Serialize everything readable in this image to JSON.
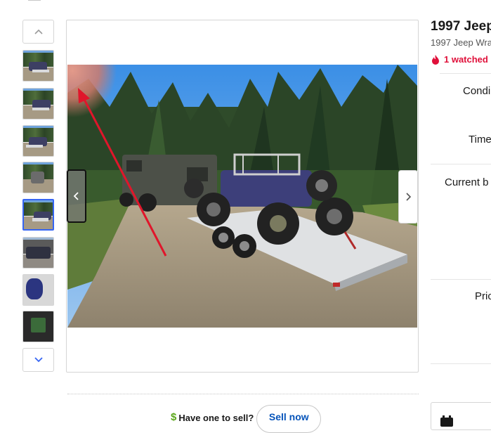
{
  "gallery": {
    "thumbnails": [
      {
        "label": "photo-1"
      },
      {
        "label": "photo-2"
      },
      {
        "label": "photo-3"
      },
      {
        "label": "photo-4"
      },
      {
        "label": "photo-5"
      },
      {
        "label": "photo-6"
      },
      {
        "label": "photo-7"
      },
      {
        "label": "photo-8"
      }
    ],
    "active_index": 4,
    "icons": {
      "up": "chevron-up-icon",
      "down": "chevron-down-icon",
      "prev": "chevron-left-icon",
      "next": "chevron-right-icon"
    }
  },
  "listing": {
    "title": "1997 Jeep",
    "subtitle": "1997 Jeep Wra",
    "watched": "1 watched",
    "labels": {
      "condition": "Condi",
      "time": "Time",
      "current_bid": "Current b",
      "price": "Pric"
    }
  },
  "sell": {
    "question": "Have one to sell?",
    "button": "Sell now"
  },
  "colors": {
    "accent_blue": "#3665f3",
    "link_blue": "#0654ba",
    "watched_red": "#e0103a",
    "dollar_green": "#5ba71b",
    "annotation_arrow": "#e0162b"
  }
}
